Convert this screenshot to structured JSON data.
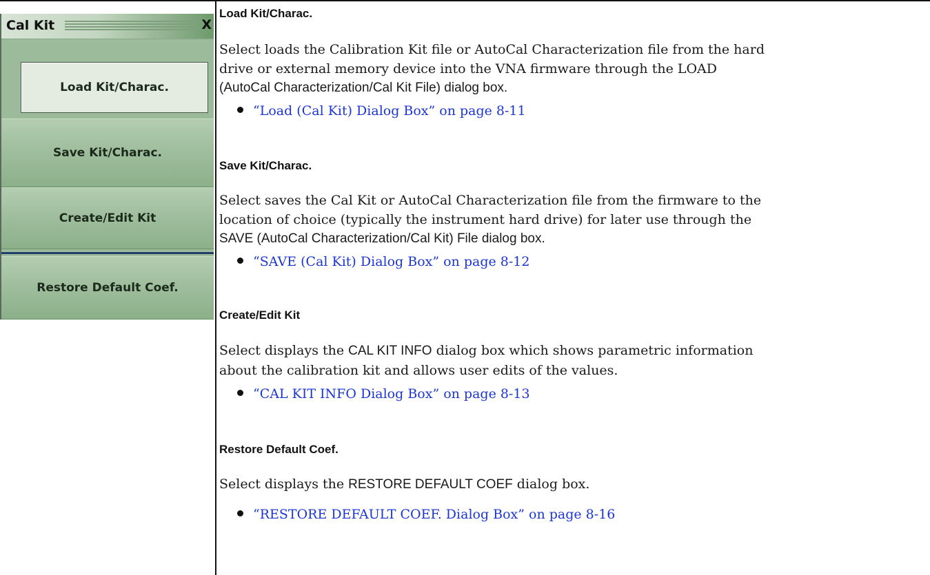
{
  "menu": {
    "title": "Cal Kit",
    "close": "X",
    "buttons": [
      {
        "label": "Load Kit/Charac."
      },
      {
        "label": "Save Kit/Charac."
      },
      {
        "label": "Create/Edit Kit"
      },
      {
        "label": "Restore Default Coef."
      }
    ]
  },
  "sections": [
    {
      "heading": "Load Kit/Charac.",
      "line1": "Select loads the Calibration Kit file or AutoCal Characterization file from the hard",
      "line2": "drive or external memory device into the VNA firmware through the LOAD",
      "line3": "(AutoCal Characterization/Cal Kit File) dialog box.",
      "link": "“Load (Cal Kit) Dialog Box” on page 8-11"
    },
    {
      "heading": "Save Kit/Charac.",
      "line1": "Select saves the Cal Kit or AutoCal Characterization file from the firmware to the",
      "line2": "location of choice (typically the instrument hard drive) for later use through the",
      "line3": "SAVE (AutoCal Characterization/Cal Kit) File dialog box.",
      "link": "“SAVE (Cal Kit) Dialog Box” on page 8-12"
    },
    {
      "heading": "Create/Edit Kit",
      "line1_a": "Select displays the ",
      "line1_b": "CAL KIT INFO",
      "line1_c": " dialog box which shows parametric information",
      "line2": "about the calibration kit and allows user edits of the values.",
      "link": "“CAL KIT INFO Dialog Box” on page 8-13"
    },
    {
      "heading": "Restore Default Coef.",
      "line1_a": "Select displays the ",
      "line1_b": "RESTORE DEFAULT COEF",
      "line1_c": " dialog box.",
      "link": "“RESTORE DEFAULT COEF. Dialog Box” on page 8-16"
    }
  ]
}
